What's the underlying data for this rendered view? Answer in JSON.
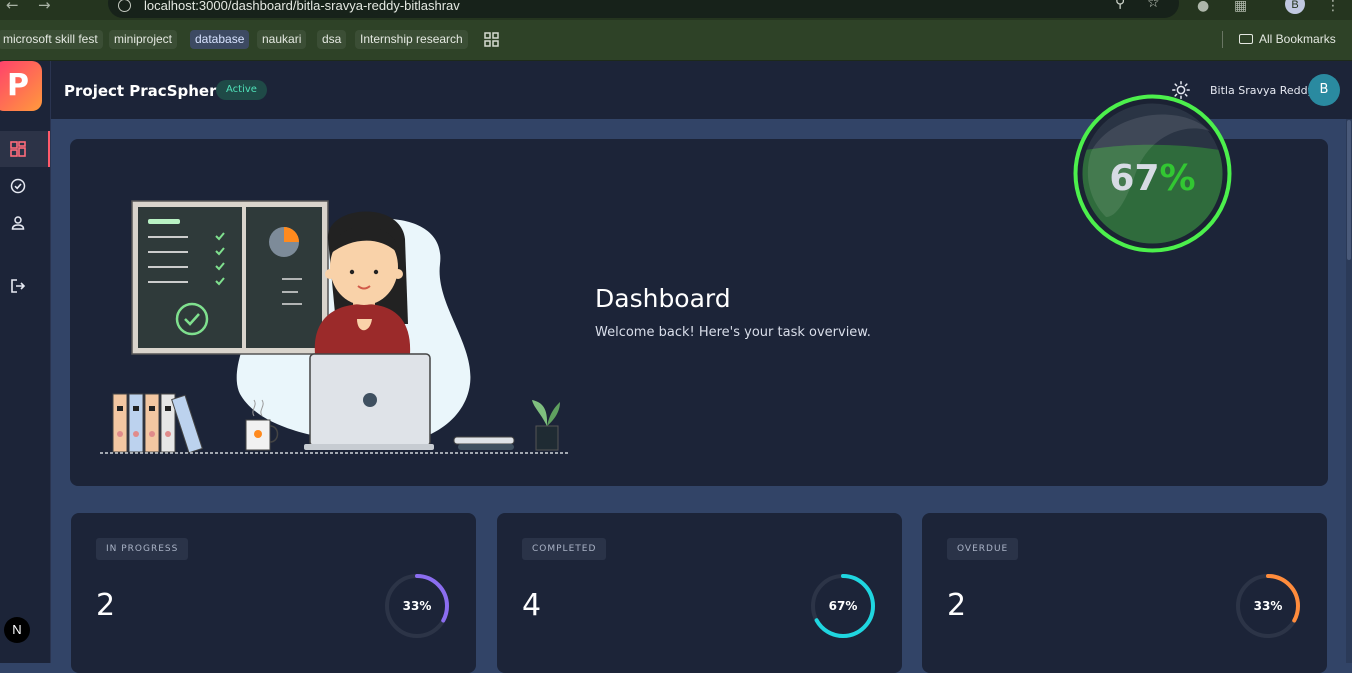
{
  "browser": {
    "url": "localhost:3000/dashboard/bitla-sravya-reddy-bitlashrav",
    "profile_initial": "B",
    "bookmarks": [
      "microsoft skill fest",
      "miniproject",
      "database",
      "naukari",
      "dsa",
      "Internship research"
    ],
    "all_bookmarks_label": "All Bookmarks"
  },
  "app": {
    "logo_letter": "P",
    "next_badge": "N",
    "sidebar_icons": [
      "dashboard-icon",
      "tasks-check-icon",
      "profile-icon",
      "logout-icon"
    ]
  },
  "header": {
    "project_title": "Project PracSphere",
    "status": "Active",
    "user_name": "Bitla Sravya Reddy",
    "avatar_initial": "B"
  },
  "hero": {
    "title": "Dashboard",
    "subtitle": "Welcome back! Here's your task overview.",
    "progress_value": "67",
    "progress_symbol": "%",
    "progress_fraction": 0.67,
    "ring_color": "#4cf04c"
  },
  "cards": [
    {
      "tag": "IN PROGRESS",
      "count": "2",
      "percent_label": "33%",
      "fraction": 0.33,
      "color": "#8b6df0"
    },
    {
      "tag": "COMPLETED",
      "count": "4",
      "percent_label": "67%",
      "fraction": 0.67,
      "color": "#1fd6e0"
    },
    {
      "tag": "OVERDUE",
      "count": "2",
      "percent_label": "33%",
      "fraction": 0.33,
      "color": "#ff8c3c"
    }
  ]
}
